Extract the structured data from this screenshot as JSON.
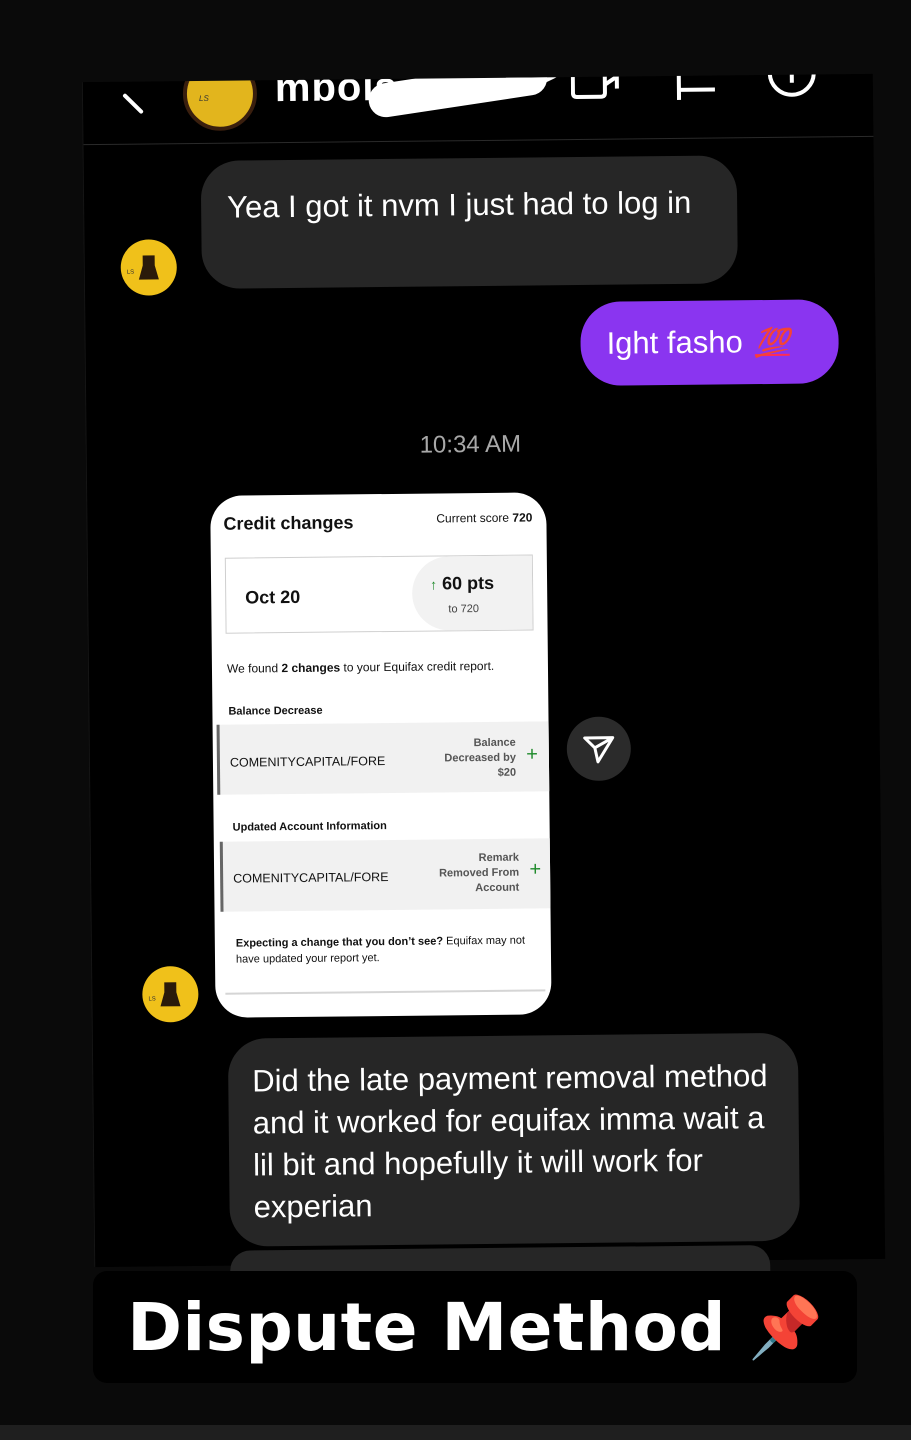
{
  "header": {
    "username": "mbois"
  },
  "messages": [
    {
      "id": "m1",
      "direction": "incoming",
      "text": "Yea I got it nvm I just had to log in"
    },
    {
      "id": "m2",
      "direction": "outgoing",
      "text": "Ight fasho",
      "emoji": "💯"
    },
    {
      "id": "m3",
      "direction": "incoming",
      "text": "Did the late payment removal method and it worked for equifax imma wait a lil bit and hopefully it will work for experian"
    }
  ],
  "timestamp": "10:34 AM",
  "credit_card": {
    "title": "Credit changes",
    "current_score_label": "Current score",
    "current_score_value": "720",
    "date": "Oct 20",
    "points_change": "60 pts",
    "points_to": "to 720",
    "found_prefix": "We found ",
    "found_count": "2 changes",
    "found_suffix": " to your Equifax credit report.",
    "sections": [
      {
        "heading": "Balance Decrease",
        "account": "COMENITYCAPITAL/FORE",
        "detail_lines": [
          "Balance",
          "Decreased by",
          "$20"
        ]
      },
      {
        "heading": "Updated Account Information",
        "account": "COMENITYCAPITAL/FORE",
        "detail_lines": [
          "Remark",
          "Removed From",
          "Account"
        ]
      }
    ],
    "footer_bold": "Expecting a change that you don’t see?",
    "footer_rest": " Equifax may not have updated your report yet."
  },
  "banner": {
    "text": "Dispute Method",
    "emoji": "📌"
  },
  "colors": {
    "outgoing_bubble": "#8a35f0",
    "incoming_bubble": "#262626",
    "avatar": "#f0c11a",
    "plus_green": "#1f8a2b"
  }
}
